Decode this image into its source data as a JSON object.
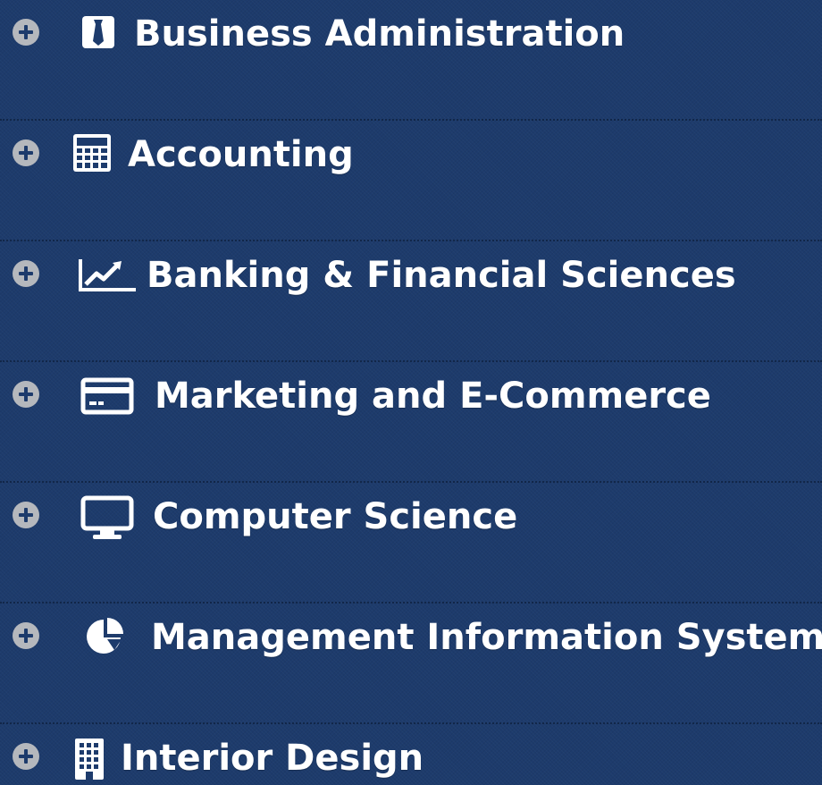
{
  "colors": {
    "background": "#1d3b6c",
    "text": "#ffffff",
    "plus_icon": "#b5b8bd"
  },
  "menu": {
    "items": [
      {
        "label": "Business Administration",
        "icon": "tie-icon"
      },
      {
        "label": "Accounting",
        "icon": "calculator-icon"
      },
      {
        "label": "Banking & Financial Sciences",
        "icon": "line-chart-icon"
      },
      {
        "label": "Marketing and E-Commerce",
        "icon": "credit-card-icon"
      },
      {
        "label": "Computer Science",
        "icon": "monitor-icon"
      },
      {
        "label": "Management Information System",
        "icon": "pie-chart-icon"
      },
      {
        "label": "Interior Design",
        "icon": "building-icon"
      }
    ]
  }
}
